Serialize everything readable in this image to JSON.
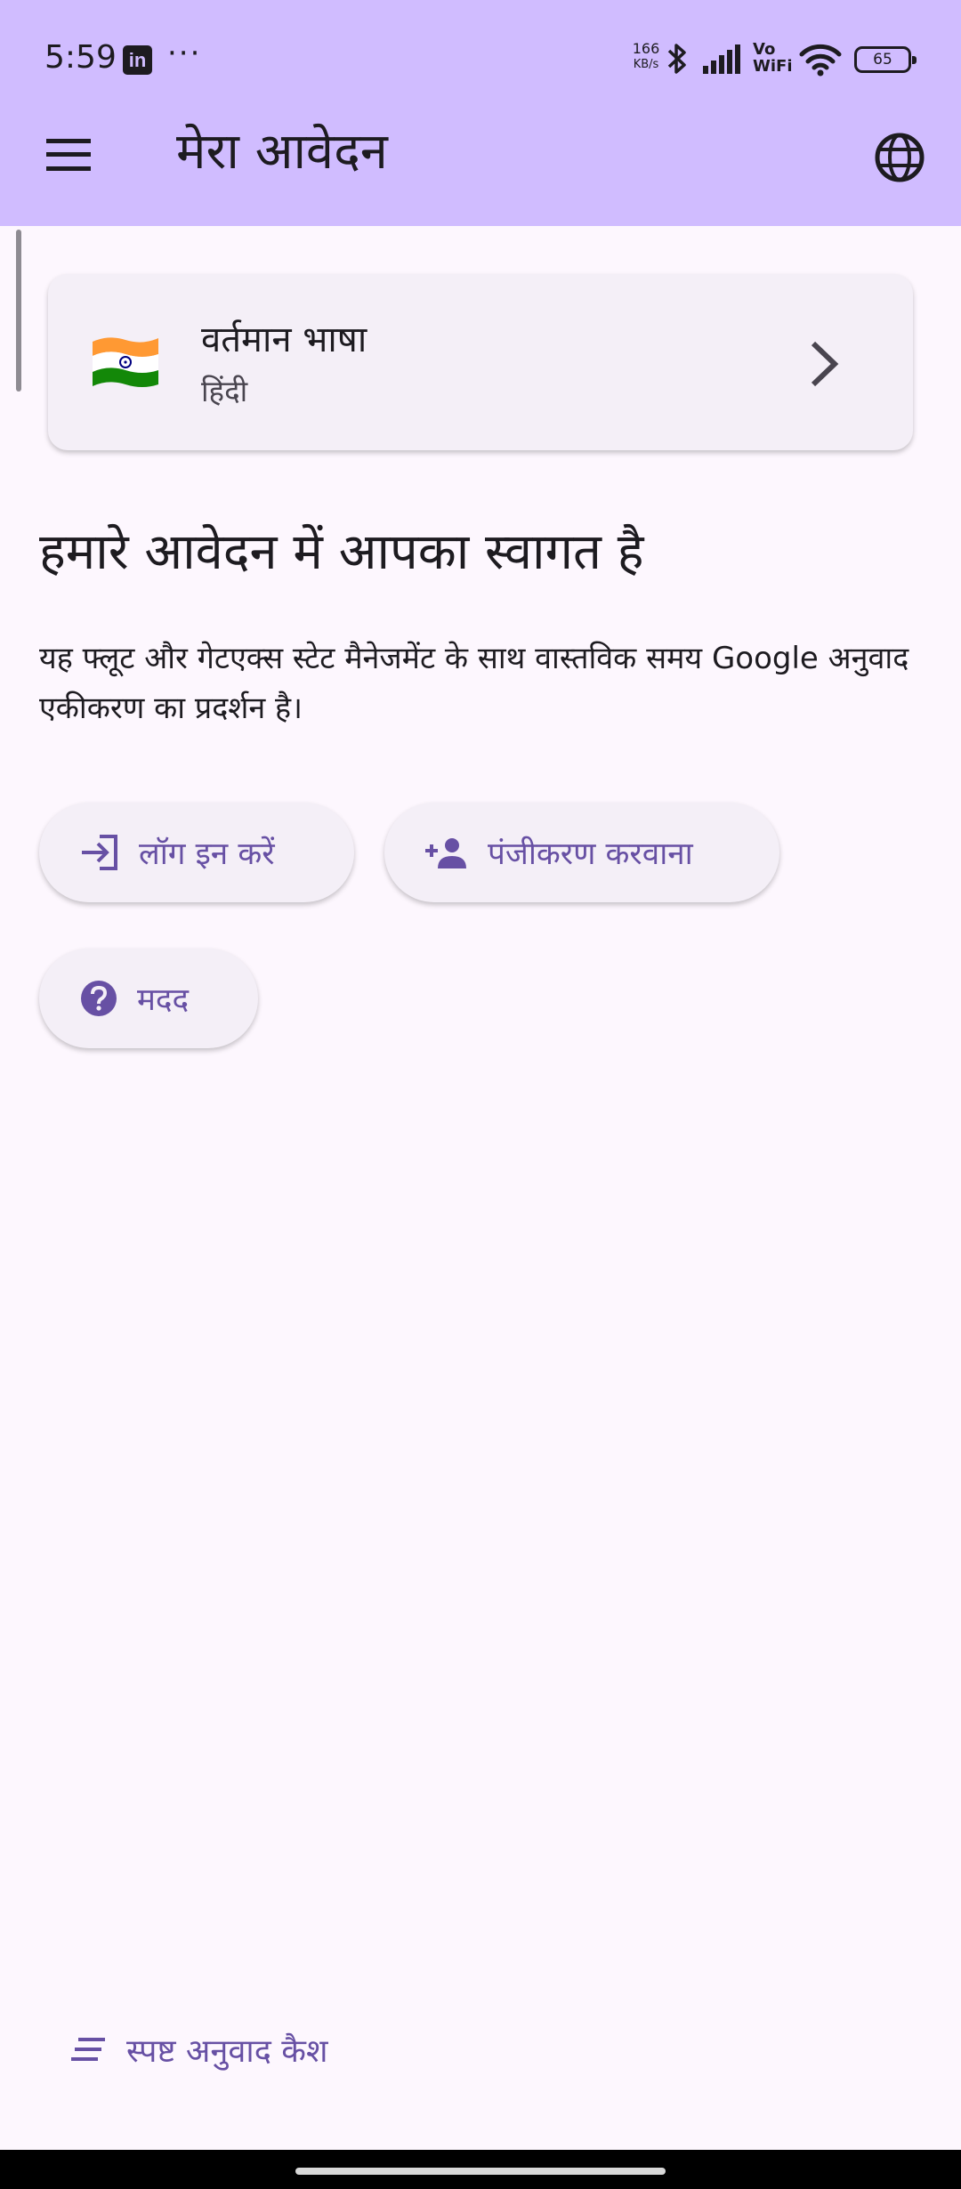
{
  "status_bar": {
    "time": "5:59",
    "linkedin_letters": "in",
    "more": "···",
    "net_speed_value": "166",
    "net_speed_unit": "KB/s",
    "vowifi_top": "Vo",
    "vowifi_bottom": "WiFi",
    "battery": "65",
    "icons": [
      "linkedin-icon",
      "more-icon",
      "bluetooth-icon",
      "signal-icon",
      "wifi-icon",
      "battery-icon"
    ]
  },
  "app_bar": {
    "title": "मेरा आवेदन",
    "icons": [
      "menu-icon",
      "globe-icon"
    ]
  },
  "language_card": {
    "title": "वर्तमान भाषा",
    "language": "हिंदी",
    "icons": [
      "india-flag-icon",
      "chevron-right-icon"
    ]
  },
  "main": {
    "welcome_heading": "हमारे आवेदन में आपका स्वागत है",
    "description": "यह फ्लूट और गेटएक्स स्टेट मैनेजमेंट के साथ वास्तविक समय Google अनुवाद एकीकरण का प्रदर्शन है।",
    "buttons": {
      "login": "लॉग इन करें",
      "register": "पंजीकरण करवाना",
      "help": "मदद"
    },
    "clear_cache": "स्पष्ट अनुवाद कैश"
  },
  "colors": {
    "app_bar": "#d0bcff",
    "background": "#fdf7fe",
    "card": "#f4eff7",
    "accent": "#6750a4",
    "text": "#1d1b20"
  }
}
